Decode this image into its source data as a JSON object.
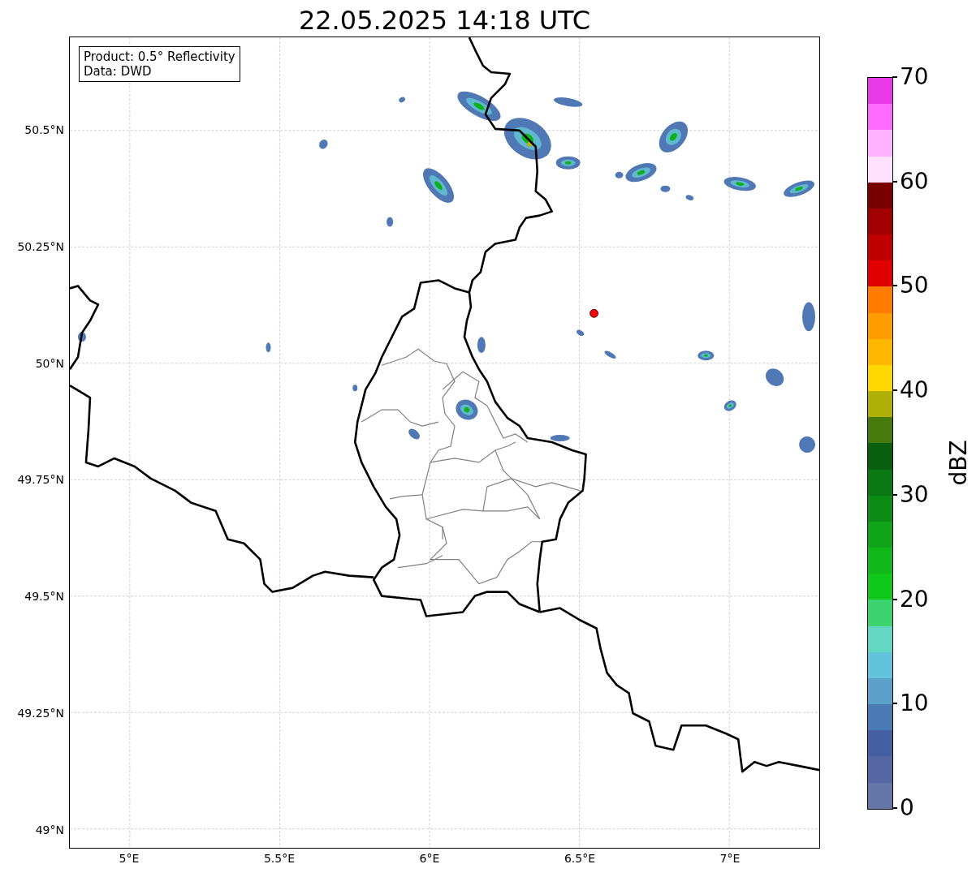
{
  "title": "22.05.2025 14:18 UTC",
  "info_box": [
    "Product: 0.5° Reflectivity",
    "Data: DWD"
  ],
  "map": {
    "lat_ticks": [
      "50.5°N",
      "50.25°N",
      "50°N",
      "49.75°N",
      "49.5°N",
      "49.25°N",
      "49°N"
    ],
    "lon_ticks": [
      "5°E",
      "5.5°E",
      "6°E",
      "6.5°E",
      "7°E"
    ]
  },
  "colorbar": {
    "label": "dBZ",
    "ticks": [
      "70",
      "60",
      "50",
      "40",
      "30",
      "20",
      "10",
      "0"
    ],
    "segments": [
      {
        "color": "#e838e8"
      },
      {
        "color": "#ff6cff"
      },
      {
        "color": "#ffb2ff"
      },
      {
        "color": "#ffe0ff"
      },
      {
        "color": "#780000"
      },
      {
        "color": "#a00000"
      },
      {
        "color": "#c00000"
      },
      {
        "color": "#e00000"
      },
      {
        "color": "#ff7c00"
      },
      {
        "color": "#ff9c00"
      },
      {
        "color": "#ffb800"
      },
      {
        "color": "#ffd800"
      },
      {
        "color": "#aeb006"
      },
      {
        "color": "#467a0c"
      },
      {
        "color": "#08600e"
      },
      {
        "color": "#0a7812"
      },
      {
        "color": "#0c8c14"
      },
      {
        "color": "#10a418"
      },
      {
        "color": "#10b81a"
      },
      {
        "color": "#10c81a"
      },
      {
        "color": "#3cd46e"
      },
      {
        "color": "#62d8c4"
      },
      {
        "color": "#63c2dc"
      },
      {
        "color": "#5aa0c8"
      },
      {
        "color": "#4a7ab4"
      },
      {
        "color": "#445fa2"
      },
      {
        "color": "#5467a2"
      },
      {
        "color": "#6475a8"
      }
    ]
  }
}
